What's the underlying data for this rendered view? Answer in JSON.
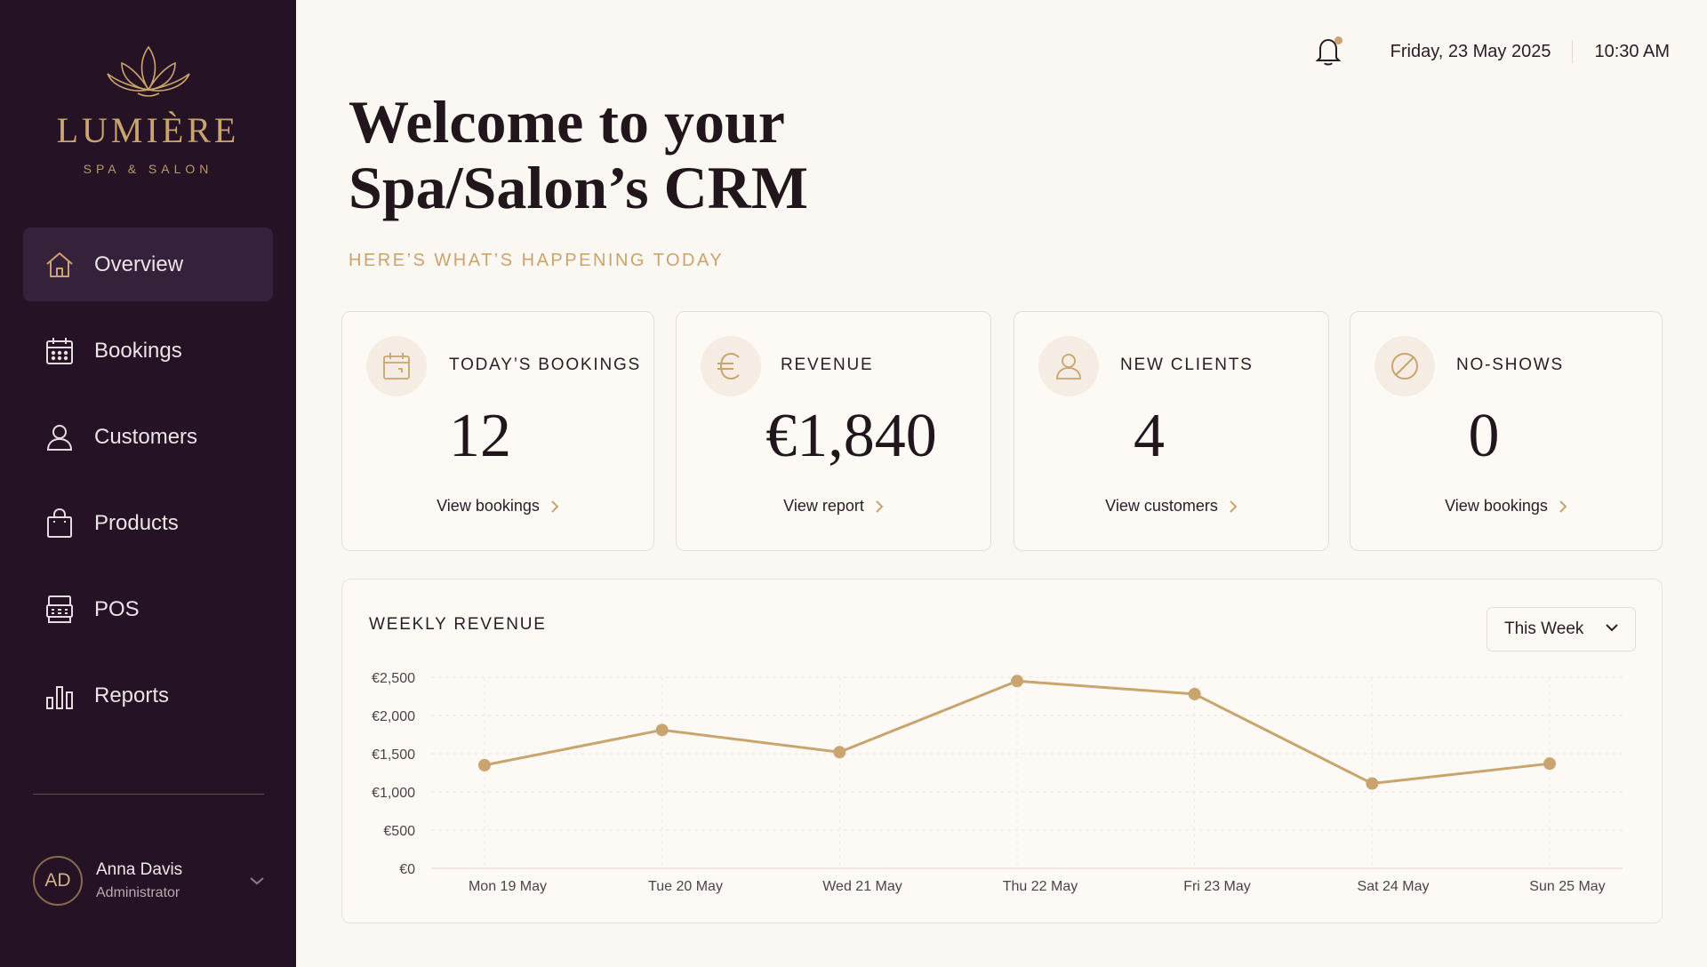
{
  "brand": {
    "name": "LUMIÈRE",
    "tagline": "SPA & SALON",
    "logo_icon": "lotus-icon",
    "accent_color": "#c9a46e",
    "sidebar_color": "#251325"
  },
  "sidebar": {
    "items": [
      {
        "label": "Overview",
        "icon": "home-icon",
        "active": true
      },
      {
        "label": "Bookings",
        "icon": "calendar-icon",
        "active": false
      },
      {
        "label": "Customers",
        "icon": "user-icon",
        "active": false
      },
      {
        "label": "Products",
        "icon": "shopping-bag-icon",
        "active": false
      },
      {
        "label": "POS",
        "icon": "register-icon",
        "active": false
      },
      {
        "label": "Reports",
        "icon": "bar-chart-icon",
        "active": false
      }
    ],
    "user": {
      "initials": "AD",
      "name": "Anna Davis",
      "role": "Administrator"
    }
  },
  "header": {
    "date": "Friday, 23 May 2025",
    "time": "10:30 AM",
    "has_notification": true
  },
  "main": {
    "title_line1": "Welcome to your",
    "title_line2": "Spa/Salon’s CRM",
    "subtitle": "HERE’S WHAT’S HAPPENING TODAY",
    "cards": [
      {
        "label": "TODAY’S BOOKINGS",
        "value": "12",
        "link": "View bookings",
        "icon": "calendar-icon"
      },
      {
        "label": "REVENUE",
        "value": "€1,840",
        "link": "View report",
        "icon": "euro-icon"
      },
      {
        "label": "NEW CLIENTS",
        "value": "4",
        "link": "View customers",
        "icon": "user-icon"
      },
      {
        "label": "NO-SHOWS",
        "value": "0",
        "link": "View bookings",
        "icon": "prohibited-icon"
      }
    ],
    "weekly": {
      "title": "WEEKLY REVENUE",
      "period": "This Week"
    }
  },
  "chart_data": {
    "type": "line",
    "title": "WEEKLY REVENUE",
    "categories": [
      "Mon 19 May",
      "Tue 20 May",
      "Wed 21 May",
      "Thu 22 May",
      "Fri 23 May",
      "Sat 24 May",
      "Sun 25 May"
    ],
    "series": [
      {
        "values": [
          1350,
          1810,
          1520,
          2450,
          2280,
          1110,
          1370
        ],
        "color": "#c9a46e"
      }
    ],
    "yticks": [
      "€0",
      "€500",
      "€1,000",
      "€1,500",
      "€2,000",
      "€2,500"
    ],
    "ylim": [
      0,
      2500
    ],
    "grid": true,
    "legend": "none"
  }
}
